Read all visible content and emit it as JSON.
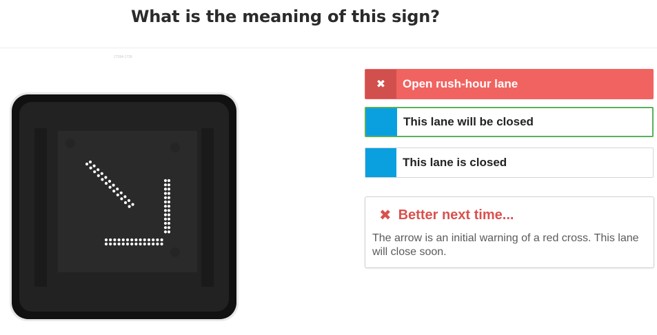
{
  "question": {
    "title": "What is the meaning of this sign?",
    "image_caption": "27394-1739"
  },
  "sign": {
    "description_icon": "diagonal-arrow-down-right-icon",
    "led_color": "#ffffff",
    "panel_color": "#1a1a1a"
  },
  "answers": [
    {
      "label": "Open rush-hour lane",
      "badge": "✖",
      "state": "wrong",
      "badge_color": "#d14f4d",
      "bg_color": "#f16360"
    },
    {
      "label": "This lane will be closed",
      "badge": "",
      "state": "selected",
      "badge_color": "#0aa0e0",
      "border_color": "#5ab05c"
    },
    {
      "label": "This lane is closed",
      "badge": "",
      "state": "unselected",
      "badge_color": "#0aa0e0"
    }
  ],
  "feedback": {
    "icon": "✖",
    "title": "Better next time...",
    "text": "The arrow is an initial warning of a red cross. This lane will close soon.",
    "accent_color": "#d9514e"
  }
}
